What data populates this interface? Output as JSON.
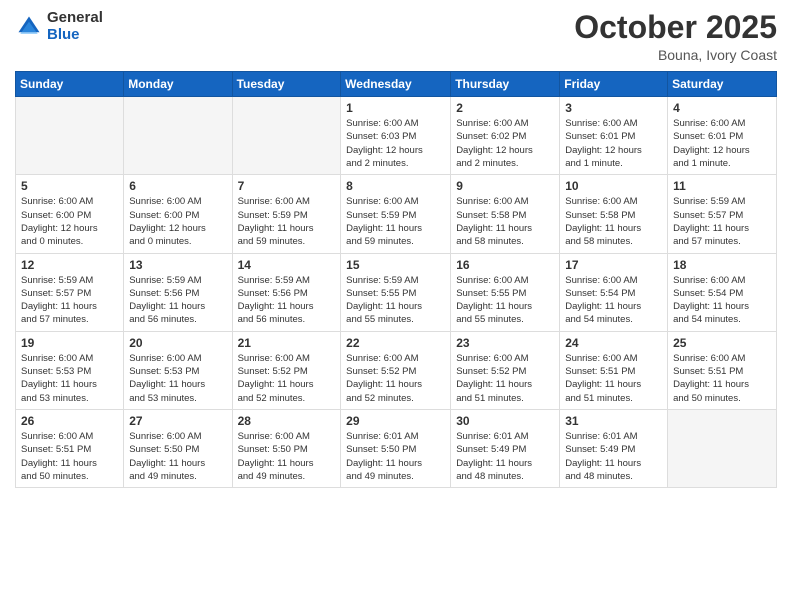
{
  "header": {
    "logo_general": "General",
    "logo_blue": "Blue",
    "month": "October 2025",
    "location": "Bouna, Ivory Coast"
  },
  "weekdays": [
    "Sunday",
    "Monday",
    "Tuesday",
    "Wednesday",
    "Thursday",
    "Friday",
    "Saturday"
  ],
  "weeks": [
    [
      {
        "day": "",
        "info": ""
      },
      {
        "day": "",
        "info": ""
      },
      {
        "day": "",
        "info": ""
      },
      {
        "day": "1",
        "info": "Sunrise: 6:00 AM\nSunset: 6:03 PM\nDaylight: 12 hours\nand 2 minutes."
      },
      {
        "day": "2",
        "info": "Sunrise: 6:00 AM\nSunset: 6:02 PM\nDaylight: 12 hours\nand 2 minutes."
      },
      {
        "day": "3",
        "info": "Sunrise: 6:00 AM\nSunset: 6:01 PM\nDaylight: 12 hours\nand 1 minute."
      },
      {
        "day": "4",
        "info": "Sunrise: 6:00 AM\nSunset: 6:01 PM\nDaylight: 12 hours\nand 1 minute."
      }
    ],
    [
      {
        "day": "5",
        "info": "Sunrise: 6:00 AM\nSunset: 6:00 PM\nDaylight: 12 hours\nand 0 minutes."
      },
      {
        "day": "6",
        "info": "Sunrise: 6:00 AM\nSunset: 6:00 PM\nDaylight: 12 hours\nand 0 minutes."
      },
      {
        "day": "7",
        "info": "Sunrise: 6:00 AM\nSunset: 5:59 PM\nDaylight: 11 hours\nand 59 minutes."
      },
      {
        "day": "8",
        "info": "Sunrise: 6:00 AM\nSunset: 5:59 PM\nDaylight: 11 hours\nand 59 minutes."
      },
      {
        "day": "9",
        "info": "Sunrise: 6:00 AM\nSunset: 5:58 PM\nDaylight: 11 hours\nand 58 minutes."
      },
      {
        "day": "10",
        "info": "Sunrise: 6:00 AM\nSunset: 5:58 PM\nDaylight: 11 hours\nand 58 minutes."
      },
      {
        "day": "11",
        "info": "Sunrise: 5:59 AM\nSunset: 5:57 PM\nDaylight: 11 hours\nand 57 minutes."
      }
    ],
    [
      {
        "day": "12",
        "info": "Sunrise: 5:59 AM\nSunset: 5:57 PM\nDaylight: 11 hours\nand 57 minutes."
      },
      {
        "day": "13",
        "info": "Sunrise: 5:59 AM\nSunset: 5:56 PM\nDaylight: 11 hours\nand 56 minutes."
      },
      {
        "day": "14",
        "info": "Sunrise: 5:59 AM\nSunset: 5:56 PM\nDaylight: 11 hours\nand 56 minutes."
      },
      {
        "day": "15",
        "info": "Sunrise: 5:59 AM\nSunset: 5:55 PM\nDaylight: 11 hours\nand 55 minutes."
      },
      {
        "day": "16",
        "info": "Sunrise: 6:00 AM\nSunset: 5:55 PM\nDaylight: 11 hours\nand 55 minutes."
      },
      {
        "day": "17",
        "info": "Sunrise: 6:00 AM\nSunset: 5:54 PM\nDaylight: 11 hours\nand 54 minutes."
      },
      {
        "day": "18",
        "info": "Sunrise: 6:00 AM\nSunset: 5:54 PM\nDaylight: 11 hours\nand 54 minutes."
      }
    ],
    [
      {
        "day": "19",
        "info": "Sunrise: 6:00 AM\nSunset: 5:53 PM\nDaylight: 11 hours\nand 53 minutes."
      },
      {
        "day": "20",
        "info": "Sunrise: 6:00 AM\nSunset: 5:53 PM\nDaylight: 11 hours\nand 53 minutes."
      },
      {
        "day": "21",
        "info": "Sunrise: 6:00 AM\nSunset: 5:52 PM\nDaylight: 11 hours\nand 52 minutes."
      },
      {
        "day": "22",
        "info": "Sunrise: 6:00 AM\nSunset: 5:52 PM\nDaylight: 11 hours\nand 52 minutes."
      },
      {
        "day": "23",
        "info": "Sunrise: 6:00 AM\nSunset: 5:52 PM\nDaylight: 11 hours\nand 51 minutes."
      },
      {
        "day": "24",
        "info": "Sunrise: 6:00 AM\nSunset: 5:51 PM\nDaylight: 11 hours\nand 51 minutes."
      },
      {
        "day": "25",
        "info": "Sunrise: 6:00 AM\nSunset: 5:51 PM\nDaylight: 11 hours\nand 50 minutes."
      }
    ],
    [
      {
        "day": "26",
        "info": "Sunrise: 6:00 AM\nSunset: 5:51 PM\nDaylight: 11 hours\nand 50 minutes."
      },
      {
        "day": "27",
        "info": "Sunrise: 6:00 AM\nSunset: 5:50 PM\nDaylight: 11 hours\nand 49 minutes."
      },
      {
        "day": "28",
        "info": "Sunrise: 6:00 AM\nSunset: 5:50 PM\nDaylight: 11 hours\nand 49 minutes."
      },
      {
        "day": "29",
        "info": "Sunrise: 6:01 AM\nSunset: 5:50 PM\nDaylight: 11 hours\nand 49 minutes."
      },
      {
        "day": "30",
        "info": "Sunrise: 6:01 AM\nSunset: 5:49 PM\nDaylight: 11 hours\nand 48 minutes."
      },
      {
        "day": "31",
        "info": "Sunrise: 6:01 AM\nSunset: 5:49 PM\nDaylight: 11 hours\nand 48 minutes."
      },
      {
        "day": "",
        "info": ""
      }
    ]
  ]
}
